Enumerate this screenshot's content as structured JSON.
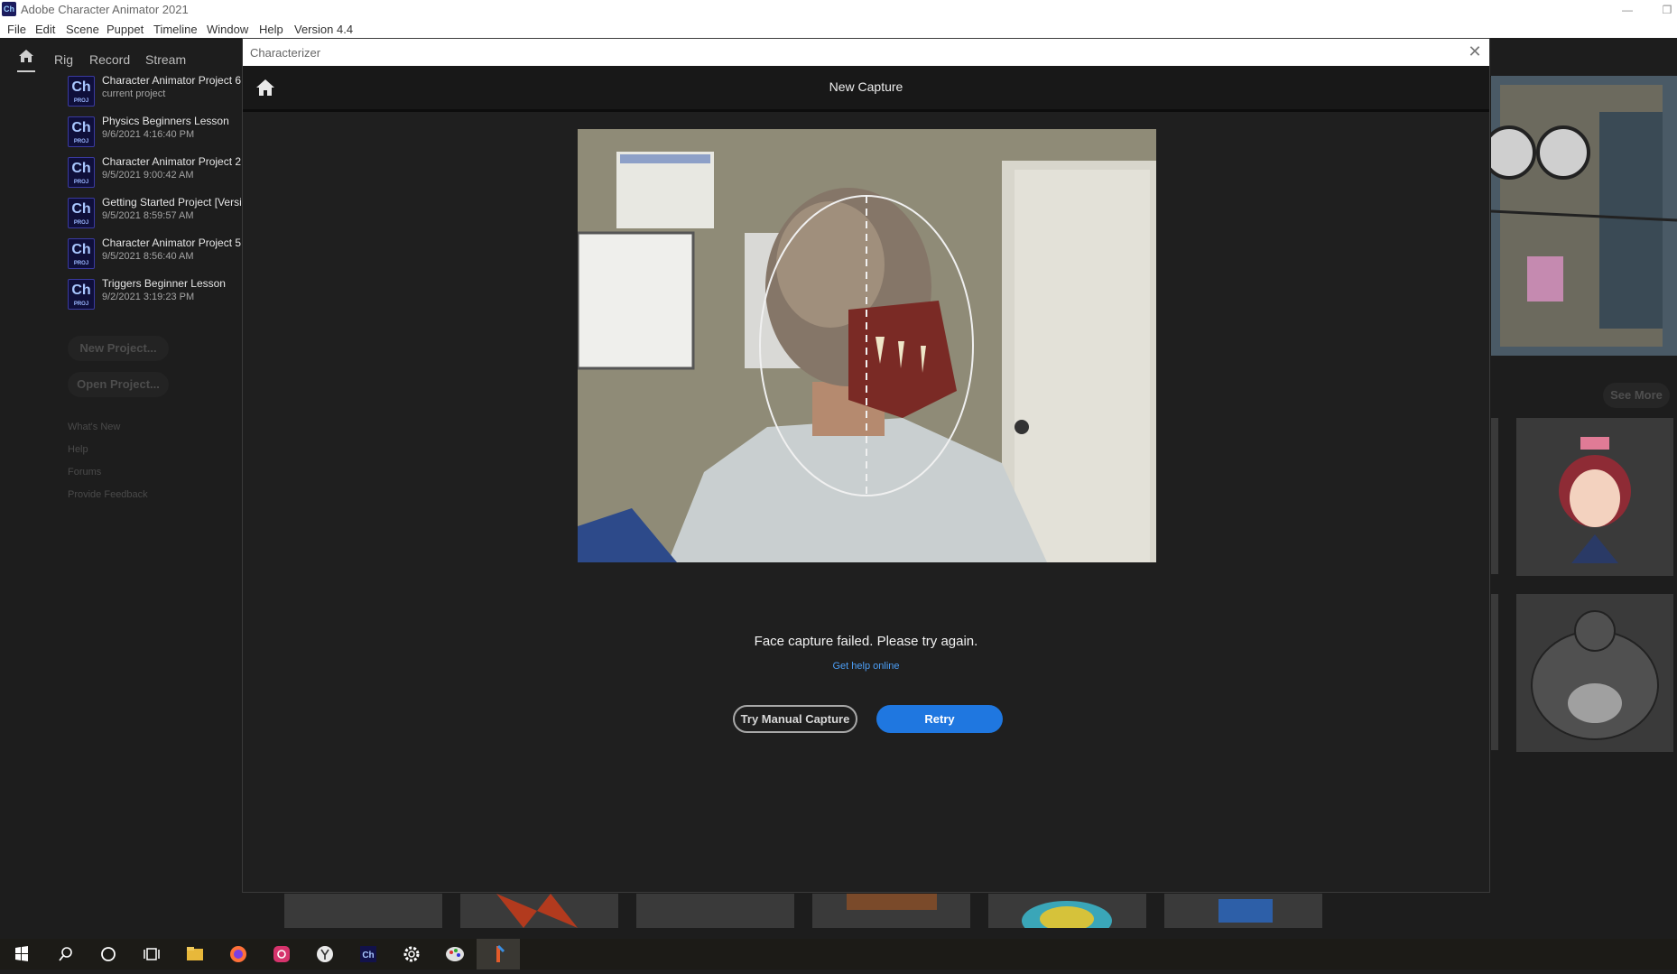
{
  "window": {
    "title": "Adobe Character Animator 2021",
    "app_icon_text": "Ch"
  },
  "menu": {
    "items": [
      "File",
      "Edit",
      "Scene",
      "Puppet",
      "Timeline",
      "Window",
      "Help",
      "Version 4.4"
    ]
  },
  "workspace": {
    "nav": [
      "Rig",
      "Record",
      "Stream"
    ]
  },
  "left_panel": {
    "projects": [
      {
        "name": "Character Animator Project 6",
        "date": "current project"
      },
      {
        "name": "Physics Beginners Lesson",
        "date": "9/6/2021 4:16:40 PM"
      },
      {
        "name": "Character Animator Project 2",
        "date": "9/5/2021 9:00:42 AM"
      },
      {
        "name": "Getting Started Project [Versi",
        "date": "9/5/2021 8:59:57 AM"
      },
      {
        "name": "Character Animator Project 5",
        "date": "9/5/2021 8:56:40 AM"
      },
      {
        "name": "Triggers Beginner Lesson",
        "date": "9/2/2021 3:19:23 PM"
      }
    ],
    "proj_badge": "Ch",
    "proj_badge_sub": "PROJ",
    "new_project": "New Project...",
    "open_project": "Open Project...",
    "links": [
      "What's New",
      "Help",
      "Forums",
      "Provide Feedback"
    ]
  },
  "right_panel": {
    "see_more": "See More"
  },
  "dialog": {
    "title": "Characterizer",
    "heading": "New Capture",
    "message": "Face capture failed. Please try again.",
    "help_link": "Get help online",
    "manual_button": "Try Manual Capture",
    "retry_button": "Retry"
  },
  "taskbar": {
    "icons": [
      "windows-start-icon",
      "search-icon",
      "cortana-icon",
      "task-view-icon",
      "file-explorer-icon",
      "firefox-icon",
      "instagram-icon",
      "yandex-icon",
      "character-animator-icon",
      "settings-icon",
      "paint-icon",
      "pinned-app-icon"
    ]
  },
  "colors": {
    "accent": "#1f77e0",
    "link": "#4c9ef5",
    "dialog_bg": "#1f1f1f",
    "panel_bg": "#1d1d1d"
  }
}
